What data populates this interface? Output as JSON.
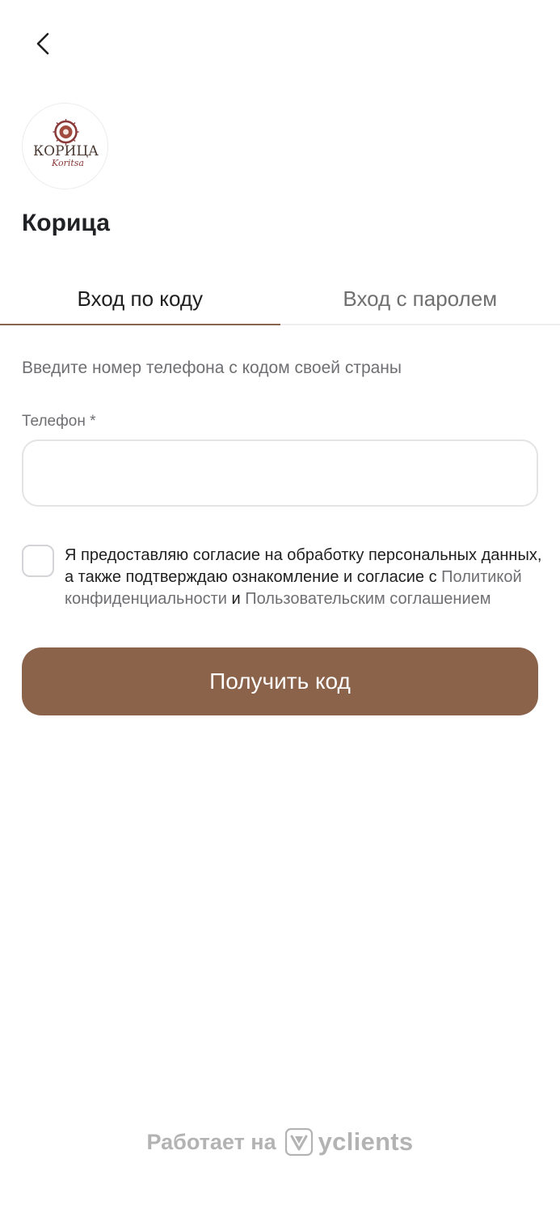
{
  "header": {
    "back_icon": "chevron-left-icon"
  },
  "company": {
    "logo_text": "КОРИЦА",
    "logo_script": "Koritsa",
    "name": "Корица"
  },
  "tabs": [
    {
      "label": "Вход по коду",
      "active": true
    },
    {
      "label": "Вход с паролем",
      "active": false
    }
  ],
  "form": {
    "hint": "Введите номер телефона с кодом своей страны",
    "phone_label": "Телефон *",
    "phone_value": "",
    "consent": {
      "checked": false,
      "text_1": "Я предоставляю согласие на обработку персональных данных, а также подтверждаю ознакомление и согласие с ",
      "privacy_link": "Политикой конфиденциальности",
      "conjunction": " и ",
      "terms_link": "Пользовательским соглашением"
    },
    "submit_label": "Получить код"
  },
  "footer": {
    "powered_by": "Работает на",
    "brand": "yclients",
    "brand_icon": "yclients-logo-icon"
  },
  "colors": {
    "accent": "#8b634b",
    "muted_text": "#6f6f73",
    "footer_gray": "#b3b3b3"
  }
}
